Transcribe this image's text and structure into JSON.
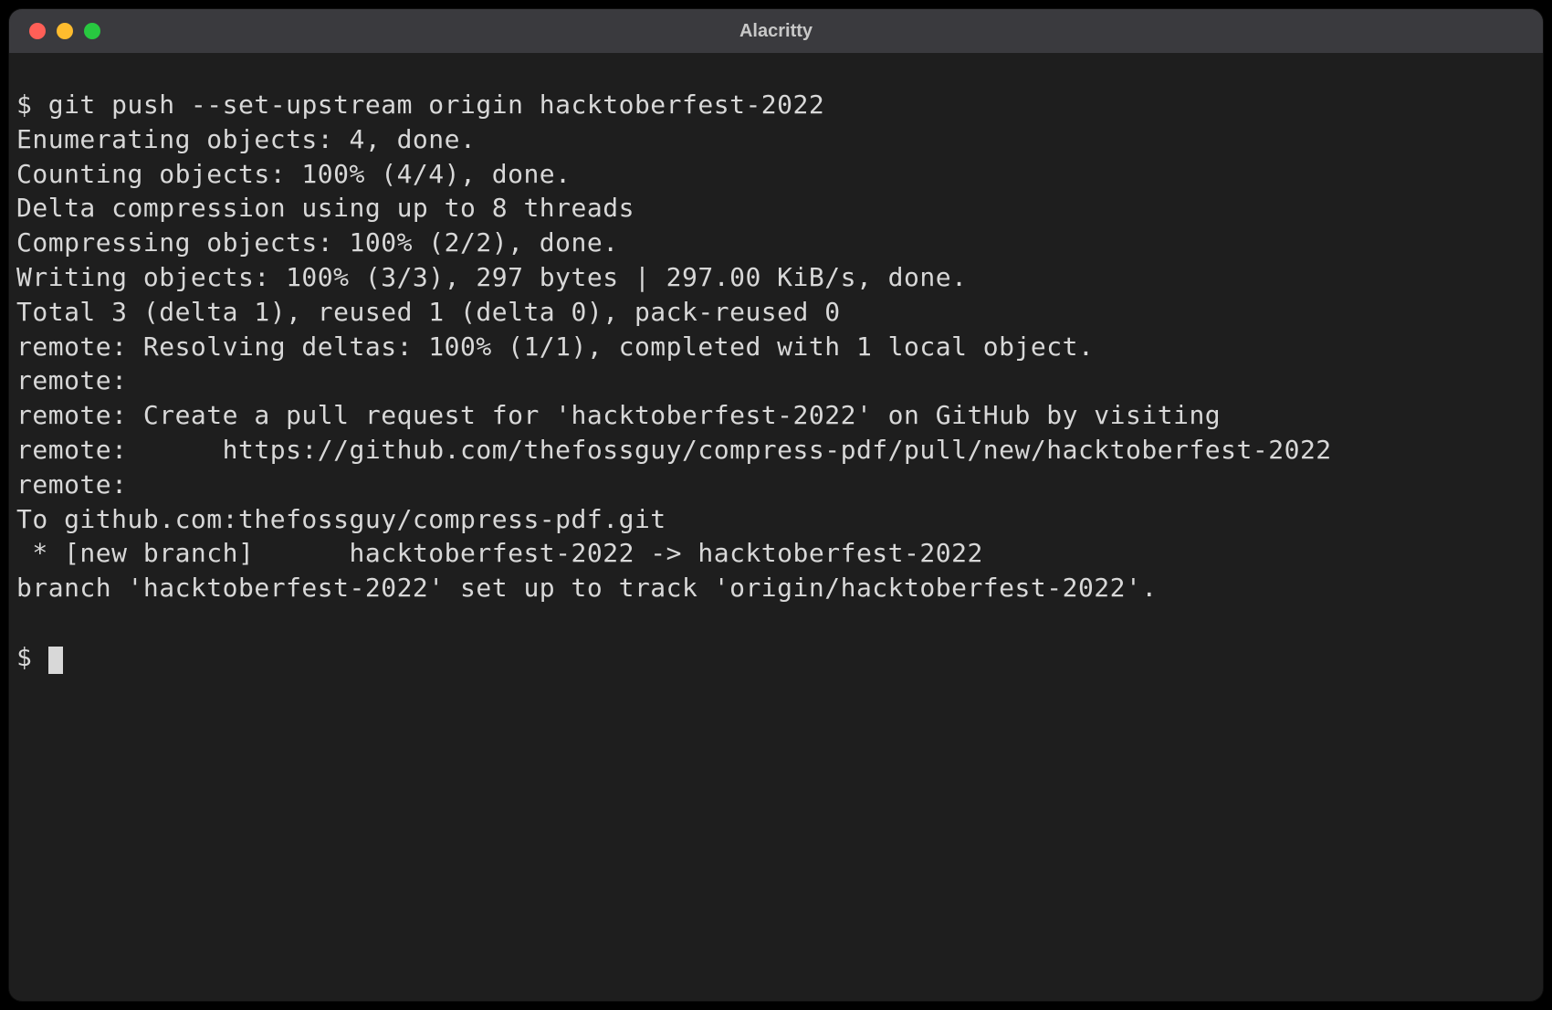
{
  "window": {
    "title": "Alacritty"
  },
  "terminal": {
    "prompt": "$ ",
    "command": "git push --set-upstream origin hacktoberfest-2022",
    "lines": [
      "Enumerating objects: 4, done.",
      "Counting objects: 100% (4/4), done.",
      "Delta compression using up to 8 threads",
      "Compressing objects: 100% (2/2), done.",
      "Writing objects: 100% (3/3), 297 bytes | 297.00 KiB/s, done.",
      "Total 3 (delta 1), reused 1 (delta 0), pack-reused 0",
      "remote: Resolving deltas: 100% (1/1), completed with 1 local object.",
      "remote:",
      "remote: Create a pull request for 'hacktoberfest-2022' on GitHub by visiting",
      "remote:      https://github.com/thefossguy/compress-pdf/pull/new/hacktoberfest-2022",
      "remote:",
      "To github.com:thefossguy/compress-pdf.git",
      " * [new branch]      hacktoberfest-2022 -> hacktoberfest-2022",
      "branch 'hacktoberfest-2022' set up to track 'origin/hacktoberfest-2022'."
    ],
    "prompt2": "$ "
  }
}
